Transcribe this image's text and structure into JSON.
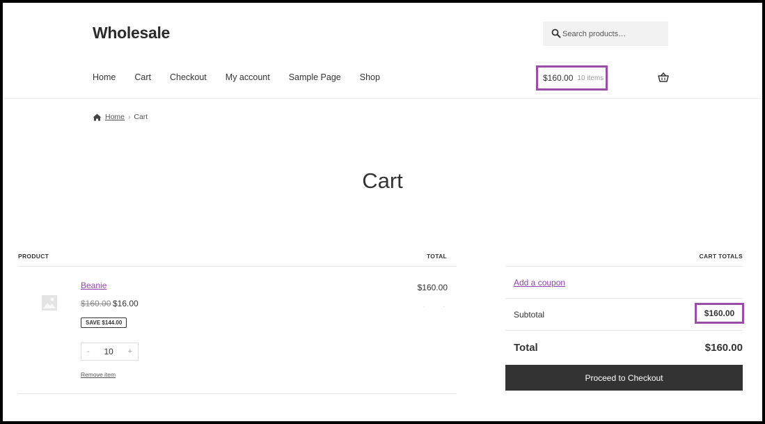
{
  "site": {
    "title": "Wholesale"
  },
  "search": {
    "placeholder": "Search products…"
  },
  "nav": {
    "items": [
      {
        "label": "Home"
      },
      {
        "label": "Cart"
      },
      {
        "label": "Checkout"
      },
      {
        "label": "My account"
      },
      {
        "label": "Sample Page"
      },
      {
        "label": "Shop"
      }
    ]
  },
  "header_cart": {
    "amount": "$160.00",
    "count": "10 items",
    "icon": "basket-icon"
  },
  "breadcrumb": {
    "home": "Home",
    "separator": "›",
    "current": "Cart"
  },
  "page": {
    "title": "Cart"
  },
  "cart_table": {
    "headers": {
      "product": "PRODUCT",
      "total": "TOTAL"
    },
    "items": [
      {
        "name": "Beanie",
        "regular_price": "$160.00",
        "sale_price": "$16.00",
        "badge": "SAVE $144.00",
        "quantity": "10",
        "qty_minus": "-",
        "qty_plus": "+",
        "remove_label": "Remove item",
        "line_total": "$160.00"
      }
    ]
  },
  "cart_totals": {
    "header": "CART TOTALS",
    "coupon_link": "Add a coupon",
    "subtotal_label": "Subtotal",
    "subtotal_value": "$160.00",
    "total_label": "Total",
    "total_value": "$160.00",
    "checkout_button": "Proceed to Checkout"
  },
  "colors": {
    "accent": "#8e44ad",
    "highlight_border": "#9b4ea8",
    "button_bg": "#333333"
  }
}
